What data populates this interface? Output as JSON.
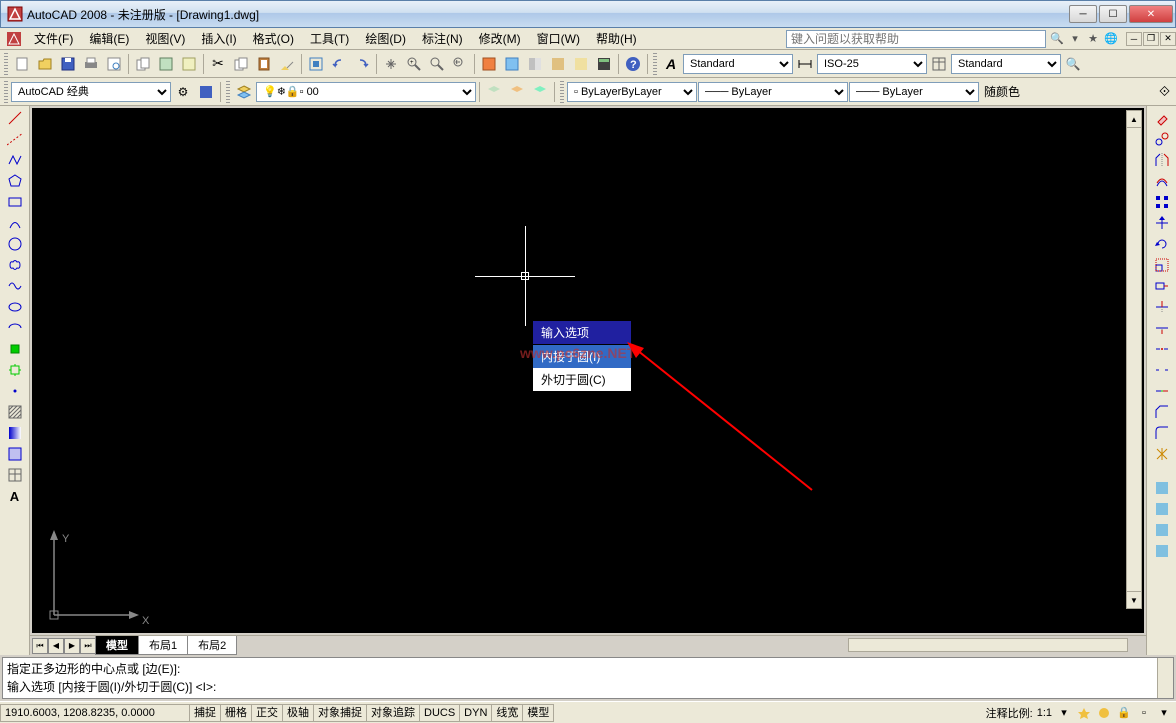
{
  "title": "AutoCAD 2008 - 未注册版 - [Drawing1.dwg]",
  "menu": {
    "items": [
      "文件(F)",
      "编辑(E)",
      "视图(V)",
      "插入(I)",
      "格式(O)",
      "工具(T)",
      "绘图(D)",
      "标注(N)",
      "修改(M)",
      "窗口(W)",
      "帮助(H)"
    ],
    "help_placeholder": "键入问题以获取帮助"
  },
  "toolbar2": {
    "workspace": "AutoCAD 经典",
    "layer": "0",
    "style1": "Standard",
    "style2": "ISO-25",
    "style3": "Standard"
  },
  "toolbar3": {
    "bylayer1": "ByLayer",
    "bylayer2": "ByLayer",
    "bylayer3": "ByLayer",
    "bycolor_label": "随颜色"
  },
  "context_menu": {
    "header": "输入选项",
    "item1": "内接于圆(I)",
    "item2": "外切于圆(C)"
  },
  "watermark": "www.pc6zne.NET",
  "ucs": {
    "x": "X",
    "y": "Y"
  },
  "tabs": {
    "model": "模型",
    "layout1": "布局1",
    "layout2": "布局2"
  },
  "command": {
    "line1": "指定正多边形的中心点或 [边(E)]:",
    "line2": "输入选项 [内接于圆(I)/外切于圆(C)] <I>:"
  },
  "status": {
    "coords": "1910.6003, 1208.8235, 0.0000",
    "toggles": [
      "捕捉",
      "栅格",
      "正交",
      "极轴",
      "对象捕捉",
      "对象追踪",
      "DUCS",
      "DYN",
      "线宽",
      "模型"
    ],
    "scale_label": "注释比例:",
    "scale_value": "1:1"
  }
}
